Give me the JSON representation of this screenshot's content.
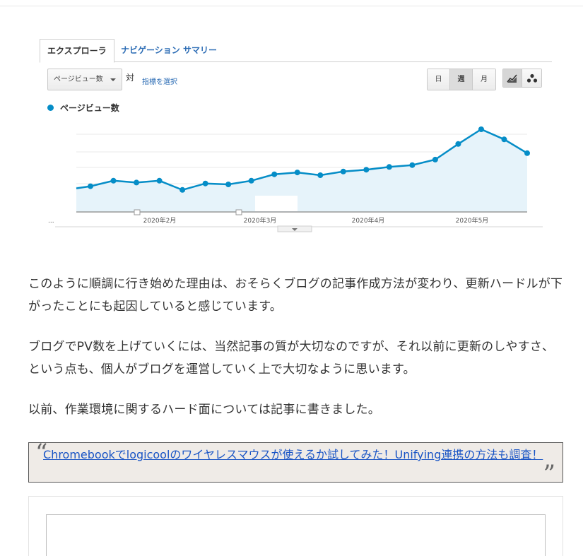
{
  "analytics": {
    "tabs": [
      {
        "label": "エクスプローラ",
        "active": true
      },
      {
        "label": "ナビゲーション サマリー",
        "active": false
      }
    ],
    "metric_select": "ページビュー数",
    "vs_label": "対",
    "choose_metric_link": "指標を選択",
    "period_buttons": [
      {
        "label": "日",
        "active": false
      },
      {
        "label": "週",
        "active": true
      },
      {
        "label": "月",
        "active": false
      }
    ],
    "view_buttons": [
      {
        "icon": "line-chart-icon",
        "active": true
      },
      {
        "icon": "motion-chart-icon",
        "active": false
      }
    ],
    "ellipsis": "...",
    "colors": {
      "series": "#058dc7",
      "fill": "#e6f3fa",
      "grid": "#e8e8e8"
    }
  },
  "chart_data": {
    "type": "area",
    "title": "",
    "series": [
      {
        "name": "ページビュー数",
        "values": [
          0.28,
          0.34,
          0.32,
          0.34,
          0.24,
          0.31,
          0.3,
          0.34,
          0.41,
          0.43,
          0.4,
          0.44,
          0.46,
          0.49,
          0.51,
          0.57,
          0.74,
          0.9,
          0.79,
          0.64
        ]
      }
    ],
    "x_tick_labels": [
      "2020年2月",
      "2020年3月",
      "2020年4月",
      "2020年5月"
    ],
    "ylim": [
      0,
      1
    ],
    "y_values_note": "y axis unlabeled; values are relative heights",
    "grid": true,
    "legend": "top-left"
  },
  "article": {
    "paragraph1": "このように順調に行き始めた理由は、おそらくブログの記事作成方法が変わり、更新ハードルが下がったことにも起因していると感じています。",
    "paragraph2": "ブログでPV数を上げていくには、当然記事の質が大切なのですが、それ以前に更新のしやすさ、という点も、個人がブログを運営していく上で大切なように思います。",
    "paragraph3": "以前、作業環境に関するハード面については記事に書きました。",
    "quote_link": "Chromebookでlogicoolのワイヤレスマウスが使えるか試してみた！Unifying連携の方法も調査！",
    "quote_open": "“",
    "quote_close": "”"
  }
}
